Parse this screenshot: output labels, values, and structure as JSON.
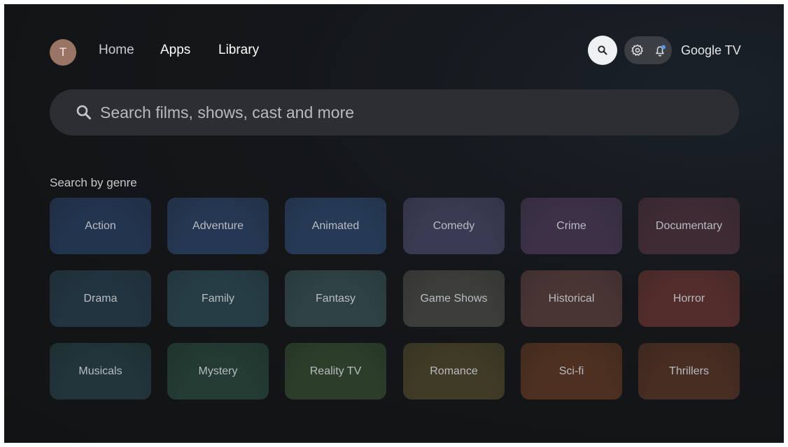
{
  "header": {
    "avatar_initial": "T",
    "nav": [
      {
        "label": "Home",
        "active": false
      },
      {
        "label": "Apps",
        "active": true
      },
      {
        "label": "Library",
        "active": true
      }
    ],
    "brand": "Google TV",
    "icons": [
      "search-icon",
      "gear-icon",
      "bell-icon"
    ]
  },
  "search": {
    "placeholder": "Search films, shows, cast and more"
  },
  "genres": {
    "heading": "Search by genre",
    "tiles": [
      {
        "label": "Action",
        "color": "#23344f"
      },
      {
        "label": "Adventure",
        "color": "#253752"
      },
      {
        "label": "Animated",
        "color": "#263a56"
      },
      {
        "label": "Comedy",
        "color": "#3a3a52"
      },
      {
        "label": "Crime",
        "color": "#3c3147"
      },
      {
        "label": "Documentary",
        "color": "#3f2b33"
      },
      {
        "label": "Drama",
        "color": "#223440"
      },
      {
        "label": "Family",
        "color": "#263d45"
      },
      {
        "label": "Fantasy",
        "color": "#2e4245"
      },
      {
        "label": "Game Shows",
        "color": "#3d3d3b"
      },
      {
        "label": "Historical",
        "color": "#4a3535"
      },
      {
        "label": "Horror",
        "color": "#522d2b"
      },
      {
        "label": "Musicals",
        "color": "#21353a"
      },
      {
        "label": "Mystery",
        "color": "#233b33"
      },
      {
        "label": "Reality TV",
        "color": "#2c3e2a"
      },
      {
        "label": "Romance",
        "color": "#3f3b26"
      },
      {
        "label": "Sci-fi",
        "color": "#4d3020"
      },
      {
        "label": "Thrillers",
        "color": "#472d22"
      }
    ]
  }
}
